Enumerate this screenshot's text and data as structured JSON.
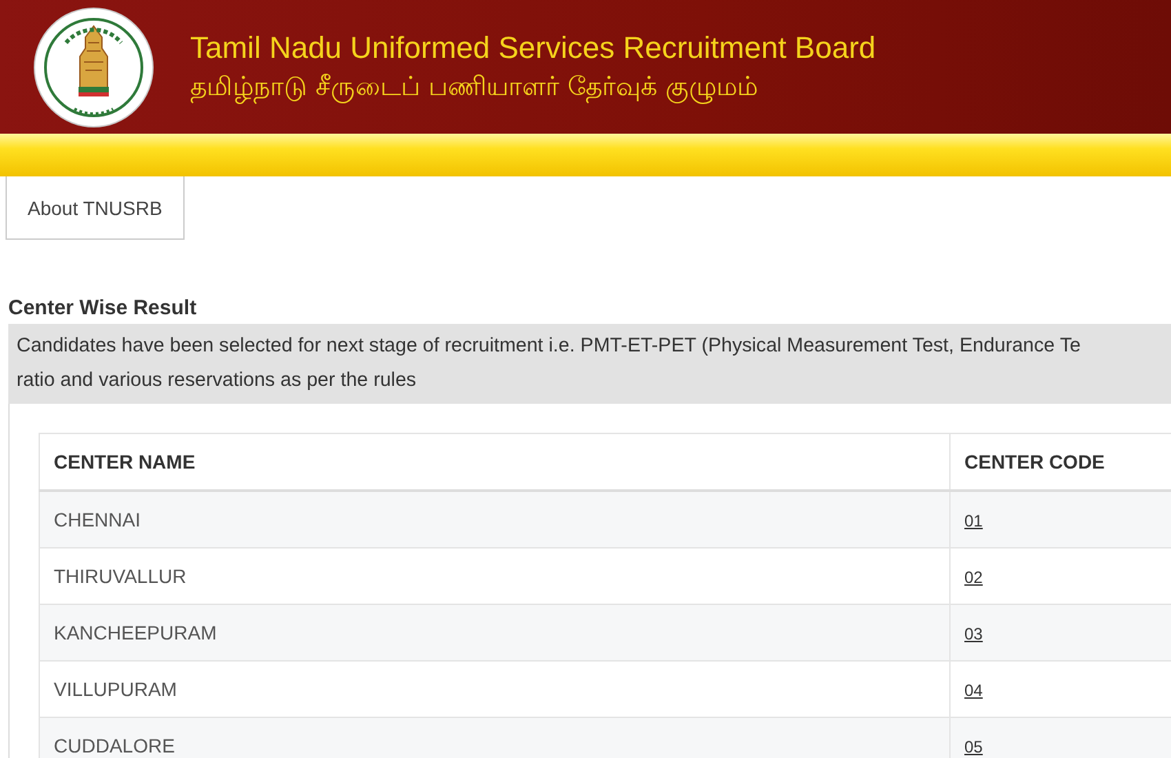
{
  "header": {
    "title": "Tamil Nadu Uniformed Services Recruitment Board",
    "subtitle": "தமிழ்நாடு சீருடைப் பணியாளர் தேர்வுக் குழுமம்"
  },
  "nav": [
    {
      "label": "About TNUSRB"
    }
  ],
  "section": {
    "heading": "Center Wise Result",
    "notice_lines": [
      "Candidates have been selected for next stage of recruitment i.e. PMT-ET-PET (Physical Measurement Test, Endurance Te",
      "ratio and various reservations as per the rules"
    ]
  },
  "table": {
    "columns": [
      "CENTER NAME",
      "CENTER CODE"
    ],
    "rows": [
      {
        "name": "CHENNAI",
        "code": "01"
      },
      {
        "name": "THIRUVALLUR",
        "code": "02"
      },
      {
        "name": "KANCHEEPURAM",
        "code": "03"
      },
      {
        "name": "VILLUPURAM",
        "code": "04"
      },
      {
        "name": "CUDDALORE",
        "code": "05"
      }
    ]
  }
}
